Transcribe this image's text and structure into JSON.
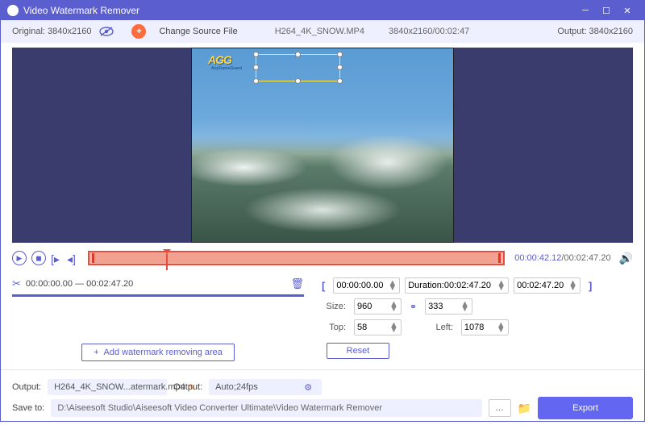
{
  "titlebar": {
    "app_name": "Video Watermark Remover"
  },
  "infobar": {
    "original_label": "Original: 3840x2160",
    "change_source": "Change Source File",
    "filename": "H264_4K_SNOW.MP4",
    "res_dur": "3840x2160/00:02:47",
    "output_label": "Output: 3840x2160"
  },
  "preview": {
    "watermark_text": "AGG",
    "watermark_sub": "AnyGameGuard"
  },
  "timeline": {
    "current": "00:00:42.12",
    "total": "/00:02:47.20"
  },
  "range_list": {
    "item1": "00:00:00.00 — 00:02:47.20"
  },
  "buttons": {
    "add_area": "Add watermark removing area",
    "reset": "Reset",
    "export": "Export"
  },
  "duration_row": {
    "start": "00:00:00.00",
    "duration_label": "Duration:00:02:47.20",
    "end": "00:02:47.20"
  },
  "size_row": {
    "label": "Size:",
    "width": "960",
    "height": "333"
  },
  "pos_row": {
    "top_label": "Top:",
    "top": "58",
    "left_label": "Left:",
    "left": "1078"
  },
  "output": {
    "file_label": "Output:",
    "file_value": "H264_4K_SNOW...atermark.mp4",
    "settings_label": "Output:",
    "settings_value": "Auto;24fps"
  },
  "save": {
    "label": "Save to:",
    "path": "D:\\Aiseesoft Studio\\Aiseesoft Video Converter Ultimate\\Video Watermark Remover"
  }
}
